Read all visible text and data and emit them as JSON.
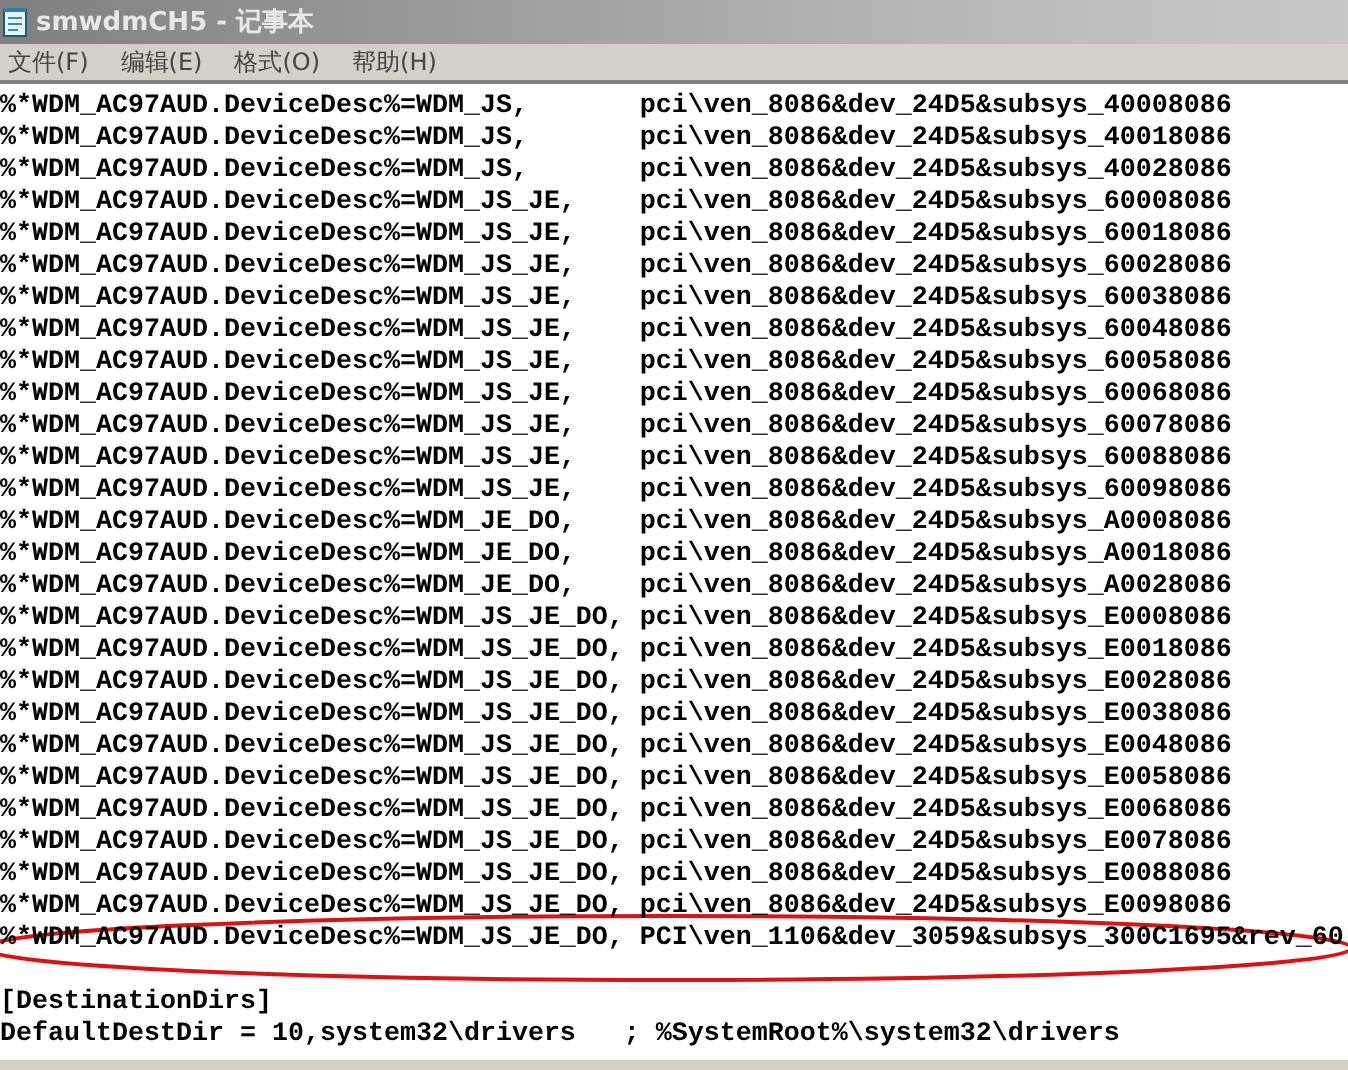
{
  "window": {
    "title": "smwdmCH5 - 记事本"
  },
  "menu": [
    {
      "label": "文件(F)"
    },
    {
      "label": "编辑(E)"
    },
    {
      "label": "格式(O)"
    },
    {
      "label": "帮助(H)"
    }
  ],
  "lines": [
    "%*WDM_AC97AUD.DeviceDesc%=WDM_JS,       pci\\ven_8086&dev_24D5&subsys_40008086",
    "%*WDM_AC97AUD.DeviceDesc%=WDM_JS,       pci\\ven_8086&dev_24D5&subsys_40018086",
    "%*WDM_AC97AUD.DeviceDesc%=WDM_JS,       pci\\ven_8086&dev_24D5&subsys_40028086",
    "%*WDM_AC97AUD.DeviceDesc%=WDM_JS_JE,    pci\\ven_8086&dev_24D5&subsys_60008086",
    "%*WDM_AC97AUD.DeviceDesc%=WDM_JS_JE,    pci\\ven_8086&dev_24D5&subsys_60018086",
    "%*WDM_AC97AUD.DeviceDesc%=WDM_JS_JE,    pci\\ven_8086&dev_24D5&subsys_60028086",
    "%*WDM_AC97AUD.DeviceDesc%=WDM_JS_JE,    pci\\ven_8086&dev_24D5&subsys_60038086",
    "%*WDM_AC97AUD.DeviceDesc%=WDM_JS_JE,    pci\\ven_8086&dev_24D5&subsys_60048086",
    "%*WDM_AC97AUD.DeviceDesc%=WDM_JS_JE,    pci\\ven_8086&dev_24D5&subsys_60058086",
    "%*WDM_AC97AUD.DeviceDesc%=WDM_JS_JE,    pci\\ven_8086&dev_24D5&subsys_60068086",
    "%*WDM_AC97AUD.DeviceDesc%=WDM_JS_JE,    pci\\ven_8086&dev_24D5&subsys_60078086",
    "%*WDM_AC97AUD.DeviceDesc%=WDM_JS_JE,    pci\\ven_8086&dev_24D5&subsys_60088086",
    "%*WDM_AC97AUD.DeviceDesc%=WDM_JS_JE,    pci\\ven_8086&dev_24D5&subsys_60098086",
    "%*WDM_AC97AUD.DeviceDesc%=WDM_JE_DO,    pci\\ven_8086&dev_24D5&subsys_A0008086",
    "%*WDM_AC97AUD.DeviceDesc%=WDM_JE_DO,    pci\\ven_8086&dev_24D5&subsys_A0018086",
    "%*WDM_AC97AUD.DeviceDesc%=WDM_JE_DO,    pci\\ven_8086&dev_24D5&subsys_A0028086",
    "%*WDM_AC97AUD.DeviceDesc%=WDM_JS_JE_DO, pci\\ven_8086&dev_24D5&subsys_E0008086",
    "%*WDM_AC97AUD.DeviceDesc%=WDM_JS_JE_DO, pci\\ven_8086&dev_24D5&subsys_E0018086",
    "%*WDM_AC97AUD.DeviceDesc%=WDM_JS_JE_DO, pci\\ven_8086&dev_24D5&subsys_E0028086",
    "%*WDM_AC97AUD.DeviceDesc%=WDM_JS_JE_DO, pci\\ven_8086&dev_24D5&subsys_E0038086",
    "%*WDM_AC97AUD.DeviceDesc%=WDM_JS_JE_DO, pci\\ven_8086&dev_24D5&subsys_E0048086",
    "%*WDM_AC97AUD.DeviceDesc%=WDM_JS_JE_DO, pci\\ven_8086&dev_24D5&subsys_E0058086",
    "%*WDM_AC97AUD.DeviceDesc%=WDM_JS_JE_DO, pci\\ven_8086&dev_24D5&subsys_E0068086",
    "%*WDM_AC97AUD.DeviceDesc%=WDM_JS_JE_DO, pci\\ven_8086&dev_24D5&subsys_E0078086",
    "%*WDM_AC97AUD.DeviceDesc%=WDM_JS_JE_DO, pci\\ven_8086&dev_24D5&subsys_E0088086",
    "%*WDM_AC97AUD.DeviceDesc%=WDM_JS_JE_DO, pci\\ven_8086&dev_24D5&subsys_E0098086",
    "%*WDM_AC97AUD.DeviceDesc%=WDM_JS_JE_DO, PCI\\ven_1106&dev_3059&subsys_300C1695&rev_60"
  ],
  "section_lines": [
    "[DestinationDirs]",
    "DefaultDestDir = 10,system32\\drivers   ; %SystemRoot%\\system32\\drivers"
  ]
}
